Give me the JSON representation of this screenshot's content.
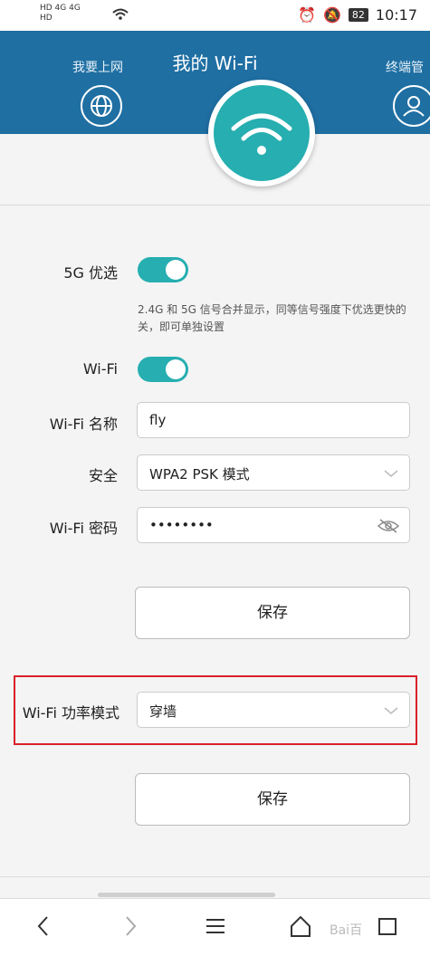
{
  "status_bar": {
    "network_left_top": "HD 4G 4G",
    "network_left_bottom": "HD",
    "battery": "82",
    "time": "10:17"
  },
  "header": {
    "title": "我的 Wi-Fi",
    "nav_left_label": "我要上网",
    "nav_right_label": "终端管"
  },
  "settings": {
    "band_label": "5G 优选",
    "band_toggle_on": true,
    "band_note_line1": "2.4G 和 5G 信号合并显示，同等信号强度下优选更快的",
    "band_note_line2": "关，即可单独设置",
    "wifi_label": "Wi-Fi",
    "wifi_toggle_on": true,
    "name_label": "Wi-Fi 名称",
    "name_value": "fly",
    "security_label": "安全",
    "security_value": "WPA2 PSK 模式",
    "password_label": "Wi-Fi 密码",
    "password_value": "••••••••",
    "save_label": "保存"
  },
  "power": {
    "label": "Wi-Fi 功率模式",
    "value": "穿墙",
    "save_label": "保存"
  },
  "watermark": "Bai百"
}
